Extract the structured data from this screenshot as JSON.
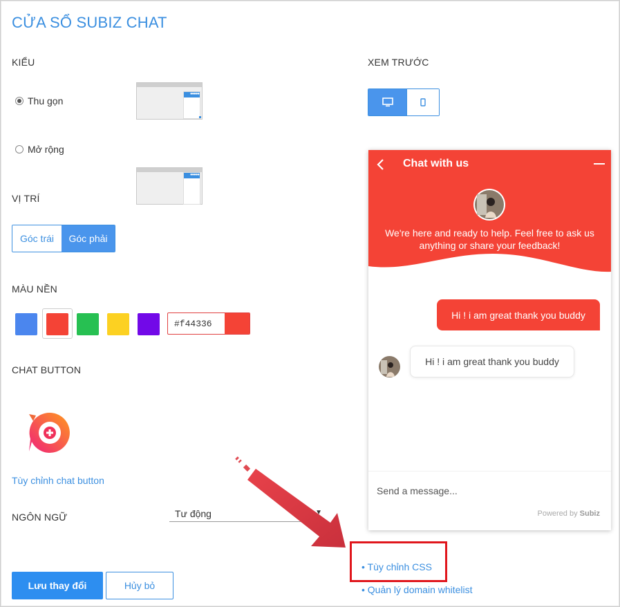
{
  "title": "CỬA SỔ SUBIZ CHAT",
  "style_section": {
    "label": "KIỂU",
    "options": [
      {
        "label": "Thu gọn",
        "selected": true
      },
      {
        "label": "Mở rộng",
        "selected": false
      }
    ]
  },
  "preview_section": {
    "label": "XEM TRƯỚC",
    "devices": [
      {
        "icon": "desktop-icon",
        "selected": true
      },
      {
        "icon": "mobile-icon",
        "selected": false
      }
    ]
  },
  "position_section": {
    "label": "VỊ TRÍ",
    "options": [
      {
        "label": "Góc trái",
        "selected": false
      },
      {
        "label": "Góc phải",
        "selected": true
      }
    ]
  },
  "background_section": {
    "label": "MÀU NỀN",
    "swatches": [
      "#4b86ee",
      "#f44336",
      "#27c052",
      "#fcd122",
      "#7209e8"
    ],
    "selected_index": 1,
    "hex_value": "#f44336"
  },
  "chat_button_section": {
    "label": "CHAT BUTTON",
    "customize_link": "Tùy chỉnh chat button"
  },
  "language_section": {
    "label": "NGÔN NGỮ",
    "value": "Tư động"
  },
  "actions": {
    "save_label": "Lưu thay đổi",
    "cancel_label": "Hủy bỏ"
  },
  "chat_preview": {
    "header_title": "Chat with us",
    "welcome": "We're here and ready to help. Feel free to ask us anything or share your feedback!",
    "messages": [
      {
        "from": "visitor",
        "text": "Hi ! i am great thank you buddy"
      },
      {
        "from": "agent",
        "text": "Hi ! i am great thank you buddy"
      }
    ],
    "input_placeholder": "Send a message...",
    "powered_prefix": "Powered by",
    "powered_brand": "Subiz",
    "accent_color": "#f44336"
  },
  "links": {
    "custom_css": "Tùy chỉnh CSS",
    "domain_whitelist": "Quản lý domain whitelist"
  }
}
